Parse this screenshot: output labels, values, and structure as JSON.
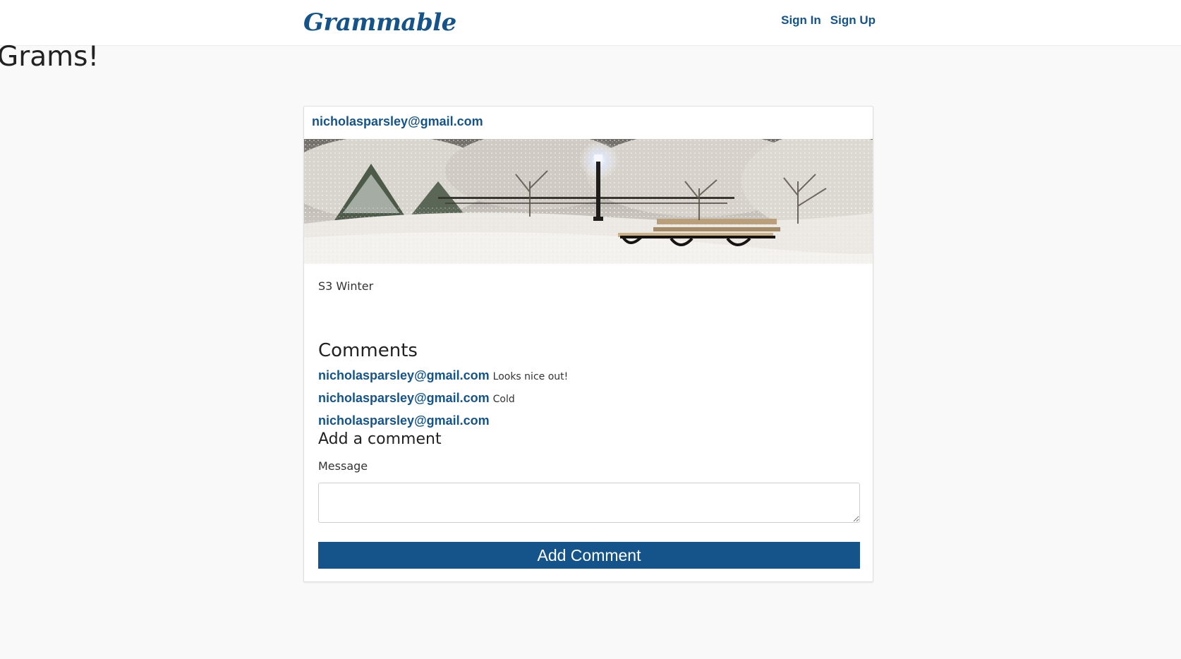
{
  "header": {
    "brand": "Grammable",
    "sign_in": "Sign In",
    "sign_up": "Sign Up"
  },
  "page": {
    "title": "Grams!"
  },
  "gram": {
    "author": "nicholasparsley@gmail.com",
    "photo_icon": "snowy-park-bench-photo",
    "caption": "S3 Winter",
    "comments_heading": "Comments",
    "comments": [
      {
        "author": "nicholasparsley@gmail.com",
        "message": "Looks nice out!"
      },
      {
        "author": "nicholasparsley@gmail.com",
        "message": "Cold"
      },
      {
        "author": "nicholasparsley@gmail.com",
        "message": ""
      }
    ],
    "add_comment_heading": "Add a comment",
    "message_label": "Message",
    "message_value": "",
    "submit_label": "Add Comment"
  },
  "colors": {
    "brand": "#14548a",
    "page_background": "#f9f9f9",
    "card_background": "#ffffff"
  }
}
